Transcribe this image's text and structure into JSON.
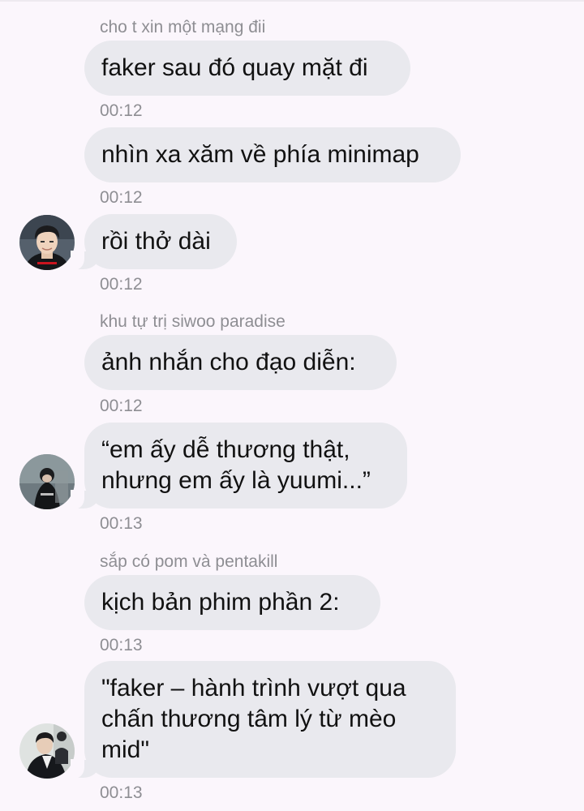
{
  "chat": {
    "groups": [
      {
        "sender": "cho t xin một mạng đii",
        "messages": [
          {
            "lines": [
              "faker sau đó quay mặt đi"
            ],
            "time": "00:12"
          },
          {
            "lines": [
              "nhìn xa xăm về phía minimap"
            ],
            "time": "00:12"
          },
          {
            "lines": [
              "rồi thở dài"
            ],
            "time": "00:12",
            "avatar": "avatar-1"
          }
        ]
      },
      {
        "sender": "khu tự trị siwoo paradise",
        "messages": [
          {
            "lines": [
              "ảnh nhắn cho đạo diễn:"
            ],
            "time": "00:12"
          },
          {
            "lines": [
              "“em ấy dễ thương thật,",
              "nhưng em ấy là yuumi...”"
            ],
            "time": "00:13",
            "avatar": "avatar-2"
          }
        ]
      },
      {
        "sender": "sắp có pom và pentakill",
        "messages": [
          {
            "lines": [
              "kịch bản phim phần 2:"
            ],
            "time": "00:13"
          },
          {
            "lines": [
              "\"faker – hành trình vượt qua",
              "chấn thương tâm lý từ mèo",
              "mid\""
            ],
            "time": "00:13",
            "avatar": "avatar-3"
          }
        ]
      }
    ]
  },
  "colors": {
    "background": "#fbf6fc",
    "bubble": "#e9e9ee",
    "meta_text": "#8e8e93",
    "message_text": "#111111"
  }
}
